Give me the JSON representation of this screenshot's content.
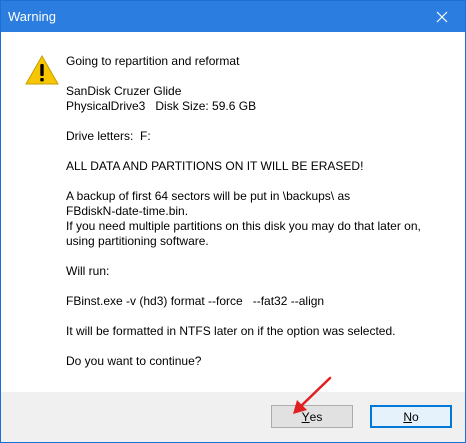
{
  "window": {
    "title": "Warning"
  },
  "icons": {
    "warning": "warning-icon",
    "close": "close-icon",
    "annotation": "red-arrow-icon"
  },
  "message": {
    "lines": [
      "Going to repartition and reformat",
      "",
      "SanDisk Cruzer Glide",
      "PhysicalDrive3   Disk Size: 59.6 GB",
      "",
      "Drive letters:  F:",
      "",
      "ALL DATA AND PARTITIONS ON IT WILL BE ERASED!",
      "",
      "A backup of first 64 sectors will be put in \\backups\\ as",
      "FBdiskN-date-time.bin.",
      "If you need multiple partitions on this disk you may do that later on,",
      "using partitioning software.",
      "",
      "Will run:",
      "",
      "FBinst.exe -v (hd3) format --force   --fat32 --align",
      "",
      "It will be formatted in NTFS later on if the option was selected.",
      "",
      "Do you want to continue?"
    ]
  },
  "buttons": {
    "yes": {
      "accel": "Y",
      "rest": "es"
    },
    "no": {
      "accel": "N",
      "rest": "o"
    }
  },
  "colors": {
    "titlebar": "#2b7de0",
    "warning_fill": "#f6c700",
    "annotation_arrow": "#e02020",
    "default_button_border": "#0078d7"
  }
}
